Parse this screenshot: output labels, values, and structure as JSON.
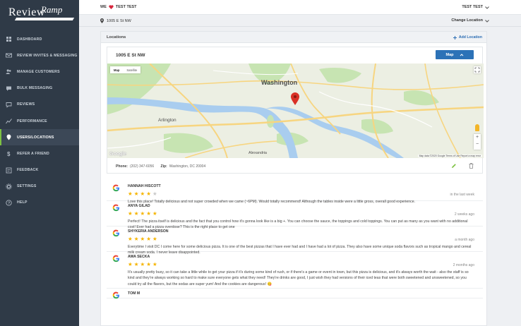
{
  "brand": {
    "name_part1": "Review",
    "name_part2": "Ramp"
  },
  "nav": [
    {
      "label": "DASHBOARD",
      "icon": "dashboard-icon",
      "active": false
    },
    {
      "label": "REVIEW INVITES & MESSAGING",
      "icon": "invite-icon",
      "active": false
    },
    {
      "label": "MANAGE CUSTOMERS",
      "icon": "customers-icon",
      "active": false
    },
    {
      "label": "BULK MESSAGING",
      "icon": "bulk-message-icon",
      "active": false
    },
    {
      "label": "REVIEWS",
      "icon": "reviews-icon",
      "active": false
    },
    {
      "label": "PERFORMANCE",
      "icon": "performance-icon",
      "active": false
    },
    {
      "label": "USERS/LOCATIONS",
      "icon": "location-pin-icon",
      "active": true
    },
    {
      "label": "REFER A FRIEND",
      "icon": "dollar-icon",
      "active": false
    },
    {
      "label": "FEEDBACK",
      "icon": "feedback-icon",
      "active": false
    },
    {
      "label": "SETTINGS",
      "icon": "gear-icon",
      "active": false
    },
    {
      "label": "HELP",
      "icon": "help-icon",
      "active": false
    }
  ],
  "topbar": {
    "we": "WE",
    "company": "TEST TEST",
    "user": "TEST TEST"
  },
  "location_bar": {
    "address": "1005 E St NW",
    "change_label": "Change Location"
  },
  "locations_card": {
    "title": "Locations",
    "add_label": "Add Location"
  },
  "location": {
    "name": "1005 E St NW",
    "map_button": "Map",
    "map_tabs": [
      "Map",
      "Satellite"
    ],
    "phone_label": "Phone:",
    "phone": "(202) 347-6056",
    "zip_label": "Zip:",
    "zip": "Washington, DC 20004"
  },
  "map": {
    "labels": {
      "city": "Washington",
      "arlington": "Arlington",
      "alexandria": "Alexandria",
      "google": "Google",
      "credits": "Map data ©2020 Google   Terms of Use   Report a map error"
    },
    "colors": {
      "water": "#a9cdef",
      "park": "#c7e4b2",
      "road": "#f7d580",
      "land": "#ecefe3"
    }
  },
  "reviews": [
    {
      "name": "HANNAH HISCOTT",
      "rating": 4,
      "time": "in the last week",
      "text": "Love this place! Totally delicious and not super crowded when we came (~6PM). Would totally recommend! Although the tables inside were a little gross, overall good experience."
    },
    {
      "name": "ANYA GILAD",
      "rating": 5,
      "time": "2 weeks ago",
      "text": "Perfect! The pizza itself is delicious and the fact that you control how it's gonna look like is a big +. You can choose the sauce, the toppings and cold toppings. You can put as many as you want with no additional cost! Ever had a pizza overdose? This is the right place to get one"
    },
    {
      "name": "SHYKERIA ANDERSON",
      "rating": 5,
      "time": "a month ago",
      "text": "Everytime I visit DC I come here for some delicious pizza. It is one of the best pizzas that I have ever had and I have had a lot of pizza. They also have some unique soda flavors such as tropical mango and cereal milk cream soda. I never leave disappointed."
    },
    {
      "name": "AWA SECKA",
      "rating": 5,
      "time": "2 months ago",
      "text": "It's usually pretty busy, so it can take a little while to get your pizza if it's during some kind of rush, or if there's a game or event in town, but this pizza is delicious, and it's always worth the wait - also the staff is so kind and they're always working so hard to make sure everyone gets what they need! They're drinks are good, I just wish they had versions of their iced teas that were both sweetened and unsweetened, so you could try all the flavors, but the sodas are super yum! And the cookies are dangerous! 😋"
    },
    {
      "name": "TOM M",
      "rating": 5,
      "time": "",
      "text": ""
    }
  ]
}
